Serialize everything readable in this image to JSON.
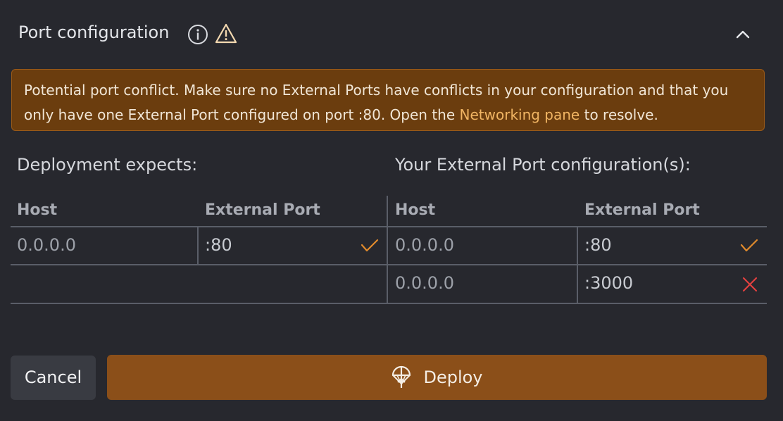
{
  "header": {
    "title": "Port configuration",
    "icons": {
      "info": "info-circle-icon",
      "warning": "warning-triangle-icon",
      "collapse": "chevron-up-icon"
    }
  },
  "alert": {
    "text": "Potential port conflict. Make sure no External Ports have conflicts in your configuration and that you only have one External Port configured on port :80. Open the ",
    "link": "Networking pane",
    "suffix": " to resolve."
  },
  "left_table": {
    "label": "Deployment expects:",
    "columns": [
      "Host",
      "External Port"
    ],
    "rows": [
      {
        "host": "0.0.0.0",
        "port": ":80",
        "status": "ok"
      }
    ]
  },
  "right_table": {
    "label": "Your External Port configuration(s):",
    "columns": [
      "Host",
      "External Port"
    ],
    "rows": [
      {
        "host": "0.0.0.0",
        "port": ":80",
        "status": "ok"
      },
      {
        "host": "0.0.0.0",
        "port": ":3000",
        "status": "error"
      }
    ]
  },
  "buttons": {
    "cancel": "Cancel",
    "deploy": "Deploy"
  },
  "colors": {
    "ok": "#e08a2c",
    "error": "#e0403f",
    "accent": "#8b4f19",
    "link": "#f1b563"
  }
}
